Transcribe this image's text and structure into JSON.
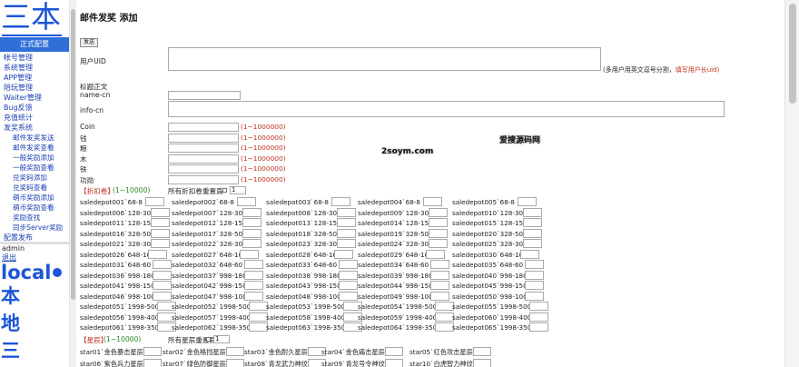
{
  "sidebar": {
    "brand": "三本",
    "env_badge": "正式配置",
    "menu": [
      {
        "label": "帐号管理",
        "sub": false
      },
      {
        "label": "系统管理",
        "sub": false
      },
      {
        "label": "APP管理",
        "sub": false
      },
      {
        "label": "陪玩管理",
        "sub": false
      },
      {
        "label": "Waiter管理",
        "sub": false
      },
      {
        "label": "Bug反馈",
        "sub": false
      },
      {
        "label": "充值统计",
        "sub": false
      },
      {
        "label": "发奖系统",
        "sub": false
      },
      {
        "label": "邮件发奖发送",
        "sub": true
      },
      {
        "label": "邮件发奖查看",
        "sub": true
      },
      {
        "label": "一般奖励添加",
        "sub": true
      },
      {
        "label": "一般奖励查看",
        "sub": true
      },
      {
        "label": "兑奖码添加",
        "sub": true
      },
      {
        "label": "兑奖码查看",
        "sub": true
      },
      {
        "label": "萌币奖励添加",
        "sub": true
      },
      {
        "label": "萌币奖励查看",
        "sub": true
      },
      {
        "label": "奖励查找",
        "sub": true
      },
      {
        "label": "同步Server奖励",
        "sub": true
      },
      {
        "label": "配置发布",
        "sub": false
      }
    ],
    "admin": "admin",
    "logout": "退出",
    "local": "local",
    "big_chars": [
      "本",
      "地",
      "三"
    ]
  },
  "page": {
    "title": "邮件发奖 添加",
    "send_button": "发送",
    "uid_label": "用户UID",
    "uid_note": "(多用户用英文逗号分割，",
    "uid_note_red": "填写用户长uid)",
    "title_label": "标题正文",
    "namecn_label": "name-cn",
    "infocn_label": "info-cn",
    "currencies": [
      {
        "label": "Coin",
        "range": "(1~1000000)"
      },
      {
        "label": "钱",
        "range": "(1~1000000)"
      },
      {
        "label": "粮",
        "range": "(1~1000000)"
      },
      {
        "label": "木",
        "range": "(1~1000000)"
      },
      {
        "label": "铁",
        "range": "(1~1000000)"
      },
      {
        "label": "功勋",
        "range": "(1~1000000)"
      }
    ],
    "discount": {
      "tag": "【折扣卷】",
      "range": "(1~10000)",
      "all_label": "所有折扣卷重置爲",
      "all_value": "1",
      "items": [
        "saledepot001`68-8",
        "saledepot002`68-8",
        "saledepot003`68-8",
        "saledepot004`68-8",
        "saledepot005`68-8",
        "saledepot006`128-30",
        "saledepot007`128-30",
        "saledepot008`128-30",
        "saledepot009`128-30",
        "saledepot010`128-30",
        "saledepot011`128-15",
        "saledepot012`128-15",
        "saledepot013`128-15",
        "saledepot014`128-15",
        "saledepot015`128-15",
        "saledepot016`328-50",
        "saledepot017`328-50",
        "saledepot018`328-50",
        "saledepot019`328-50",
        "saledepot020`328-50",
        "saledepot021`328-30",
        "saledepot022`328-30",
        "saledepot023`328-30",
        "saledepot024`328-30",
        "saledepot025`328-30",
        "saledepot026`648-100",
        "saledepot027`648-100",
        "saledepot028`648-100",
        "saledepot029`648-100",
        "saledepot030`648-100",
        "saledepot031`648-60",
        "saledepot032`648-60",
        "saledepot033`648-60",
        "saledepot034`648-60",
        "saledepot035`648-60",
        "saledepot036`998-180",
        "saledepot037`998-180",
        "saledepot038`998-180",
        "saledepot039`998-180",
        "saledepot040`998-180",
        "saledepot041`998-150",
        "saledepot042`998-150",
        "saledepot043`998-150",
        "saledepot044`998-150",
        "saledepot045`998-150",
        "saledepot046`998-100",
        "saledepot047`998-100",
        "saledepot048`998-100",
        "saledepot049`998-100",
        "saledepot050`998-100",
        "saledepot051`1998-500",
        "saledepot052`1998-500",
        "saledepot053`1998-500",
        "saledepot054`1998-500",
        "saledepot055`1998-500",
        "saledepot056`1998-400",
        "saledepot057`1998-400",
        "saledepot058`1998-400",
        "saledepot059`1998-400",
        "saledepot060`1998-400",
        "saledepot061`1998-350",
        "saledepot062`1998-350",
        "saledepot063`1998-350",
        "saledepot064`1998-350",
        "saledepot065`1998-350"
      ]
    },
    "stars": {
      "tag": "【星辰】",
      "range": "(1~10000)",
      "all_label": "所有星辰重置爲",
      "all_value": "1",
      "items": [
        "star01`金色暴击星辰",
        "star02`金色格挡星辰",
        "star03`金色耐久星辰",
        "star04`金色痛击星辰",
        "star05`红色攻击星辰",
        "star06`紫色兵力星辰",
        "star07`绿色防御星辰",
        "star08`青龙武力神纹",
        "star09`青龙号令神纹",
        "star10`白虎智力神纹"
      ]
    },
    "watermark_1": "2soym.com",
    "watermark_2": "爱搜源码网"
  }
}
